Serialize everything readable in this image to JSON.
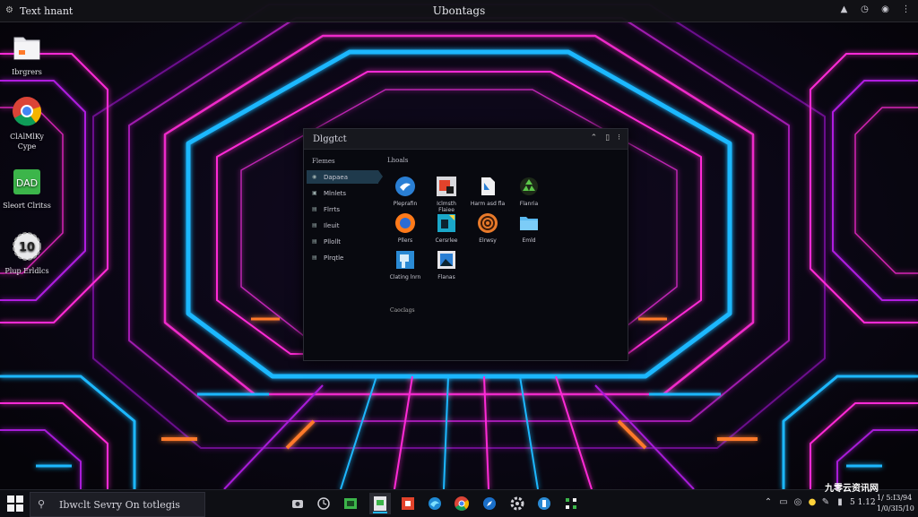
{
  "topbar": {
    "app_name": "Text hnant",
    "center_title": "Ubontags"
  },
  "desktop_icons": [
    {
      "label": "Ibrgrers"
    },
    {
      "label": "ClAlMlKy Cype"
    },
    {
      "label": "Sleort Clritss",
      "badge": "DAD"
    },
    {
      "label": "Plup Erldlcs",
      "badge": "10"
    }
  ],
  "window": {
    "title": "Dlggtct",
    "sidebar_head": "Flemes",
    "sidebar_items": [
      "Dapaea",
      "Mlnlets",
      "Flrrts",
      "Ileuit",
      "Pllollt",
      "Plrqtle"
    ],
    "main_head": "Lhoals",
    "apps": [
      {
        "label": "Pleprafin"
      },
      {
        "label": "Iclmsth Flaiee"
      },
      {
        "label": "Harm asd fla"
      },
      {
        "label": "Flanria"
      },
      {
        "label": "Pllers"
      },
      {
        "label": "Cersrlee"
      },
      {
        "label": "Elrwsy"
      },
      {
        "label": "Emld"
      },
      {
        "label": "Clating lnrn"
      },
      {
        "label": "Flanas"
      }
    ],
    "footer": "Caoclags"
  },
  "taskbar": {
    "search_text": "Ibwclt Sevry On totlegis",
    "clock_line1": "1/ 5:I3/94",
    "clock_line2": "1/0/3I5/10",
    "time_short": "5 1.12",
    "watermark": "九零云资讯网"
  },
  "colors": {
    "neon_pink": "#ff2bd6",
    "neon_blue": "#1fb8ff",
    "neon_orange": "#ff7a2b",
    "sidebar_active": "#1f3a4c"
  }
}
